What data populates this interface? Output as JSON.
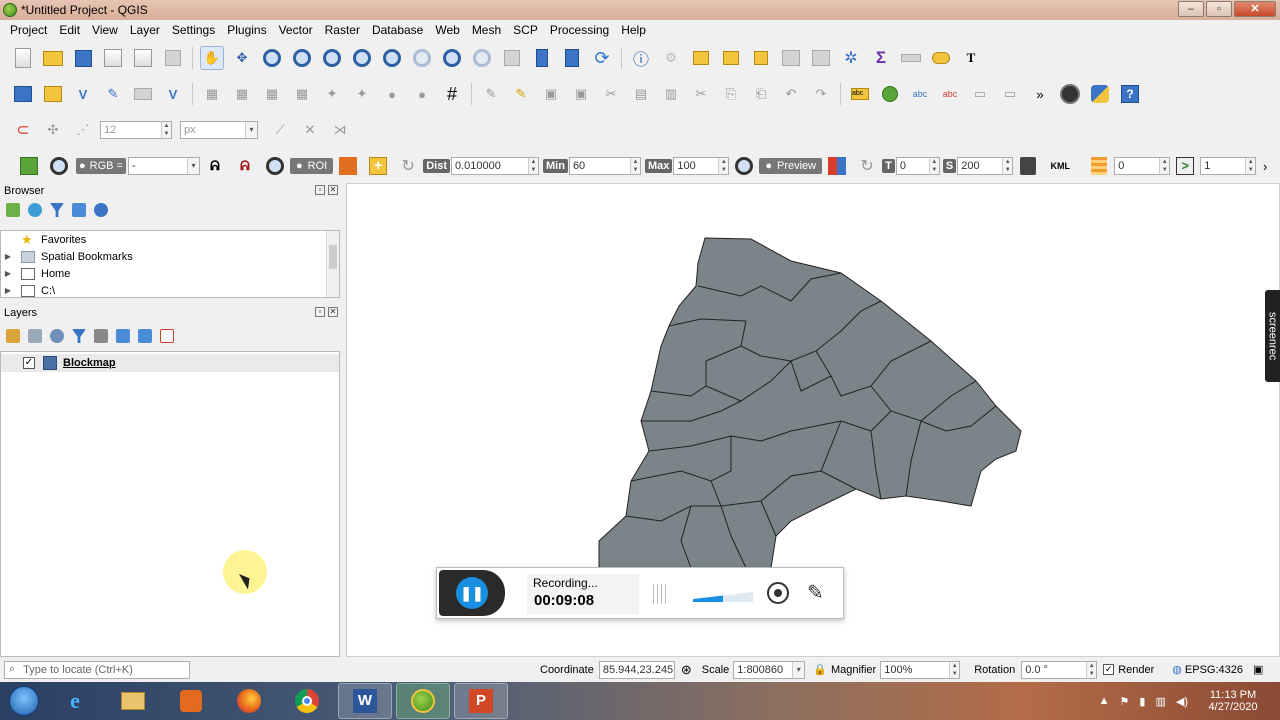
{
  "window": {
    "title": "*Untitled Project - QGIS",
    "controls": {
      "minimize": "–",
      "maximize": "▫",
      "close": "✕"
    }
  },
  "menu": [
    "Project",
    "Edit",
    "View",
    "Layer",
    "Settings",
    "Plugins",
    "Vector",
    "Raster",
    "Database",
    "Web",
    "Mesh",
    "SCP",
    "Processing",
    "Help"
  ],
  "toolbar3": {
    "size_value": "12",
    "unit_value": "px"
  },
  "scp_toolbar": {
    "rgb_label": "RGB =",
    "rgb_value": "-",
    "roi_label": "ROI",
    "dist_label": "Dist",
    "dist_value": "0.010000",
    "min_label": "Min",
    "min_value": "60",
    "max_label": "Max",
    "max_value": "100",
    "preview_label": "Preview",
    "t_label": "T",
    "t_value": "0",
    "s_label": "S",
    "s_value": "200",
    "kml_label": "KML",
    "band_value": "0",
    "step_value": "1"
  },
  "browser": {
    "title": "Browser",
    "items": [
      {
        "label": "Favorites",
        "icon": "star-icon",
        "expandable": false
      },
      {
        "label": "Spatial Bookmarks",
        "icon": "bookmark-icon",
        "expandable": true
      },
      {
        "label": "Home",
        "icon": "home-icon",
        "expandable": true
      },
      {
        "label": "C:\\",
        "icon": "folder-icon",
        "expandable": true
      }
    ]
  },
  "layers": {
    "title": "Layers",
    "items": [
      {
        "label": "Blockmap",
        "checked": true,
        "color": "#4a6fa5"
      }
    ]
  },
  "recorder": {
    "status": "Recording...",
    "time": "00:09:08"
  },
  "screenrec_tab": "screenrec",
  "status": {
    "locate_placeholder": "Type to locate (Ctrl+K)",
    "coordinate_label": "Coordinate",
    "coordinate_value": "85.944,23.245",
    "scale_label": "Scale",
    "scale_value": "1:800860",
    "magnifier_label": "Magnifier",
    "magnifier_value": "100%",
    "rotation_label": "Rotation",
    "rotation_value": "0.0 °",
    "render_label": "Render",
    "crs_label": "EPSG:4326"
  },
  "taskbar": {
    "time": "11:13 PM",
    "date": "4/27/2020"
  },
  "colors": {
    "map_fill": "#7b8489",
    "map_stroke": "#222222",
    "recorder_button": "#1a8fe0"
  }
}
